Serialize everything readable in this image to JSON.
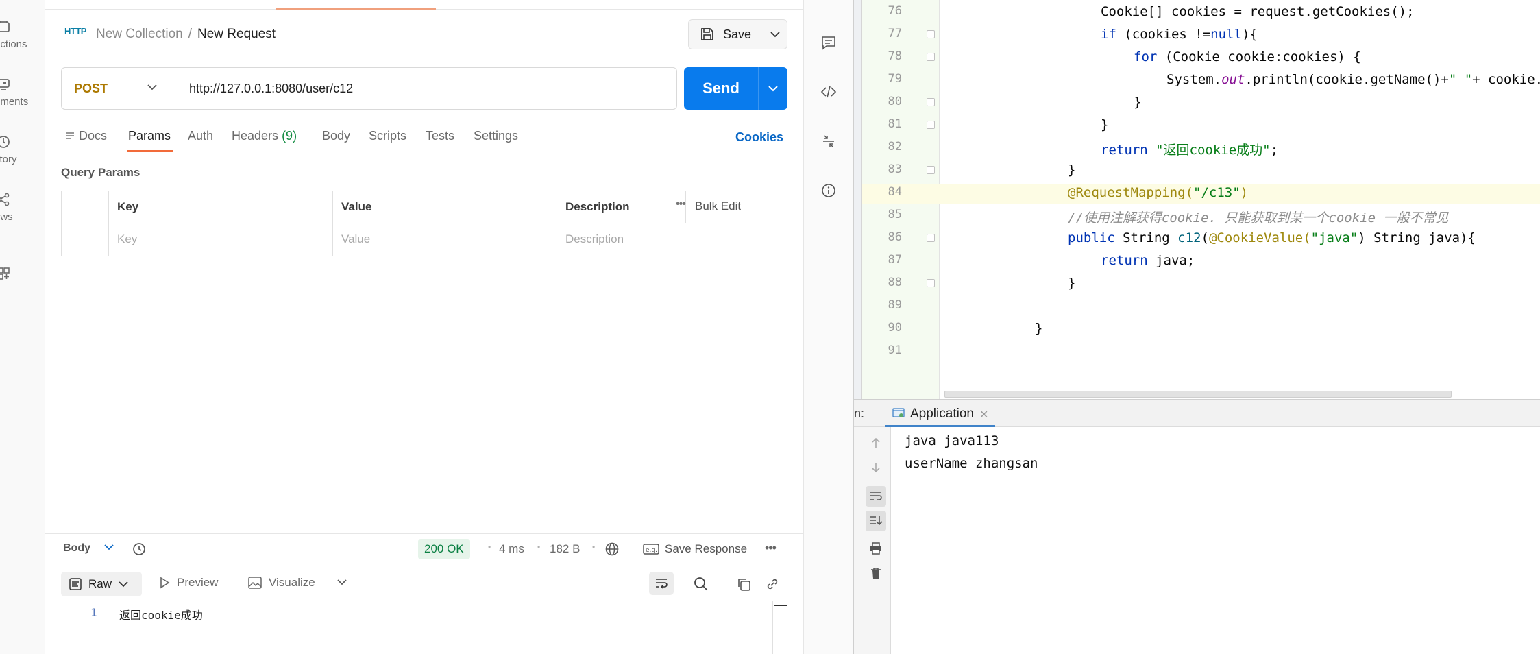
{
  "left_rail": {
    "items": [
      {
        "label": "ections",
        "icon": "collections-icon"
      },
      {
        "label": "nments",
        "icon": "environments-icon"
      },
      {
        "label": "story",
        "icon": "history-icon"
      },
      {
        "label": "ows",
        "icon": "flows-icon"
      },
      {
        "label": "",
        "icon": "add-workbench-icon"
      }
    ]
  },
  "header": {
    "http_icon": "HTTP",
    "collection": "New Collection",
    "separator": "/",
    "request": "New Request",
    "save_label": "Save"
  },
  "request": {
    "method": "POST",
    "url": "http://127.0.0.1:8080/user/c12",
    "send_label": "Send"
  },
  "tabs": {
    "docs": "Docs",
    "params": "Params",
    "auth": "Auth",
    "headers": "Headers",
    "headers_count": "(9)",
    "body": "Body",
    "scripts": "Scripts",
    "tests": "Tests",
    "settings": "Settings",
    "cookies": "Cookies"
  },
  "query_params": {
    "title": "Query Params",
    "columns": [
      "Key",
      "Value",
      "Description"
    ],
    "bulk_edit": "Bulk Edit",
    "more": "•••",
    "placeholders": [
      "Key",
      "Value",
      "Description"
    ]
  },
  "response_bar": {
    "body_label": "Body",
    "status": "200 OK",
    "time": "4 ms",
    "size": "182 B",
    "dot": "•",
    "save_response": "Save Response",
    "more": "•••"
  },
  "view_bar": {
    "raw": "Raw",
    "preview": "Preview",
    "visualize": "Visualize"
  },
  "response_body": {
    "line_number": "1",
    "text": "返回cookie成功"
  },
  "editor": {
    "line_numbers": [
      "76",
      "77",
      "78",
      "79",
      "80",
      "81",
      "82",
      "83",
      "84",
      "85",
      "86",
      "87",
      "88",
      "89",
      "90",
      "91"
    ],
    "lines": {
      "l76": "Cookie[] cookies = request.getCookies();",
      "l77_if": "if",
      "l77_rest": " (cookies !=",
      "l77_null": "null",
      "l77_end": "){",
      "l78_for": "for",
      "l78_rest": " (Cookie cookie:cookies) {",
      "l79_a": "System.",
      "l79_out": "out",
      "l79_b": ".println(cookie.getName()+",
      "l79_str": "\" \"",
      "l79_c": "+ cookie.getValue(",
      "l80": "}",
      "l81": "}",
      "l82_ret": "return",
      "l82_str": "\"返回cookie成功\"",
      "l82_end": ";",
      "l83": "}",
      "l84_ann": "@RequestMapping(",
      "l84_str": "\"/c13\"",
      "l84_end": ")",
      "l85": "//使用注解获得cookie. 只能获取到某一个cookie 一般不常见",
      "l86_pub": "public",
      "l86_a": " String ",
      "l86_fn": "c12",
      "l86_b": "(",
      "l86_ann": "@CookieValue(",
      "l86_str": "\"java\"",
      "l86_c": ") String java){",
      "l87_ret": "return",
      "l87_rest": " java;",
      "l88": "}",
      "l90": "}"
    }
  },
  "run_panel": {
    "label": "n:",
    "tab": "Application",
    "close": "✕",
    "console_lines": [
      "java java113",
      "userName zhangsan"
    ]
  }
}
